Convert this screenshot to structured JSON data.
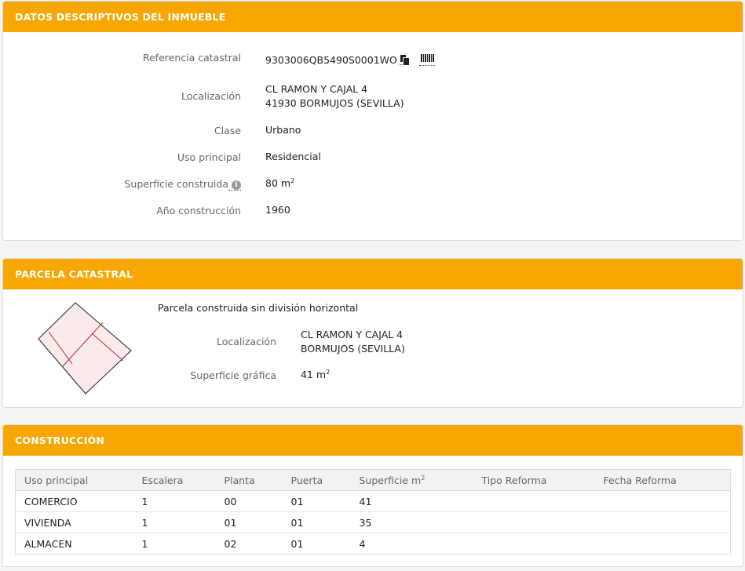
{
  "datos": {
    "header": "DATOS DESCRIPTIVOS DEL INMUEBLE",
    "referencia_label": "Referencia catastral",
    "referencia_value": "9303006QB5490S0001WO",
    "localizacion_label": "Localización",
    "localizacion_line1": "CL RAMON Y CAJAL 4",
    "localizacion_line2": "41930 BORMUJOS (SEVILLA)",
    "clase_label": "Clase",
    "clase_value": "Urbano",
    "uso_label": "Uso principal",
    "uso_value": "Residencial",
    "superficie_label": "Superficie construida",
    "superficie_value": "80 m",
    "superficie_unit_sup": "2",
    "info_glyph": "i",
    "anio_label": "Año construcción",
    "anio_value": "1960"
  },
  "parcela": {
    "header": "PARCELA CATASTRAL",
    "descripcion": "Parcela construida sin división horizontal",
    "localizacion_label": "Localización",
    "localizacion_line1": "CL RAMON Y CAJAL 4",
    "localizacion_line2": "BORMUJOS (SEVILLA)",
    "superficie_label": "Superficie gráfica",
    "superficie_value": "41 m",
    "superficie_unit_sup": "2"
  },
  "construccion": {
    "header": "CONSTRUCCIÓN",
    "columns": [
      "Uso principal",
      "Escalera",
      "Planta",
      "Puerta",
      "Superficie m",
      "Tipo Reforma",
      "Fecha Reforma"
    ],
    "superficie_unit_sup": "2",
    "rows": [
      [
        "COMERCIO",
        "1",
        "00",
        "01",
        "41",
        "",
        ""
      ],
      [
        "VIVIENDA",
        "1",
        "01",
        "01",
        "35",
        "",
        ""
      ],
      [
        "ALMACEN",
        "1",
        "02",
        "01",
        "4",
        "",
        ""
      ]
    ]
  },
  "colors": {
    "header_bg": "#f8a601",
    "parcel_fill": "#fbeaea",
    "parcel_inner_line": "#b22a3a",
    "parcel_outline": "#222222"
  }
}
